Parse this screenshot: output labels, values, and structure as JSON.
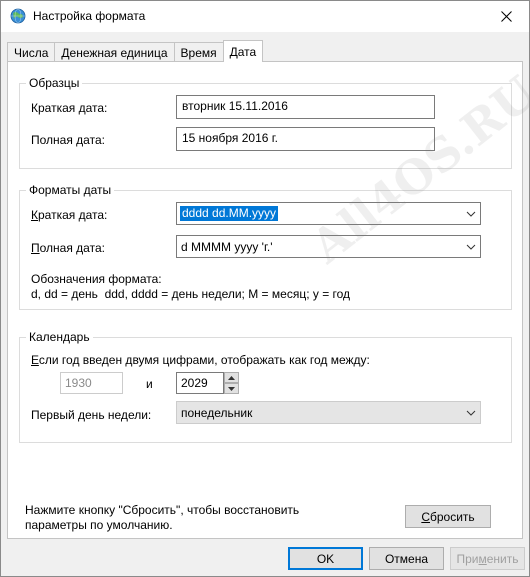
{
  "window": {
    "title": "Настройка формата"
  },
  "tabs": [
    {
      "label": "Числа"
    },
    {
      "label": "Денежная единица"
    },
    {
      "label": "Время"
    },
    {
      "label": "Дата",
      "active": true
    }
  ],
  "samples": {
    "group_label": "Образцы",
    "short_label": "Краткая дата:",
    "short_value": "вторник 15.11.2016",
    "long_label": "Полная дата:",
    "long_value": "15 ноября 2016 г."
  },
  "formats": {
    "group_label": "Форматы даты",
    "short_label_accel": "К",
    "short_label_rest": "раткая дата:",
    "short_value": "dddd dd.MM.yyyy",
    "long_label_accel": "П",
    "long_label_rest": "олная дата:",
    "long_value": "d MMMM yyyy 'г.'",
    "notation_title": "Обозначения формата:",
    "notation_text": "d, dd = день  ddd, dddd = день недели; M = месяц; y = год"
  },
  "calendar": {
    "group_label": "Календарь",
    "twodigit_accel": "Е",
    "twodigit_rest": "сли год введен двумя цифрами, отображать как год между:",
    "year_from": "1930",
    "and_label": "и",
    "year_to": "2029",
    "firstday_label": "Первый день недели:",
    "firstday_value": "понедельник"
  },
  "footer": {
    "reset_hint_line1": "Нажмите кнопку \"Сбросить\", чтобы восстановить",
    "reset_hint_line2": "параметры по умолчанию.",
    "reset_accel": "С",
    "reset_rest": "бросить"
  },
  "buttons": {
    "ok": "OK",
    "cancel": "Отмена",
    "apply_pre": "При",
    "apply_accel": "м",
    "apply_rest": "енить"
  },
  "watermark": "All4OS.RU",
  "colors": {
    "accent": "#0078d7",
    "dialog_bg": "#f0f0f0",
    "panel_bg": "#ffffff"
  }
}
